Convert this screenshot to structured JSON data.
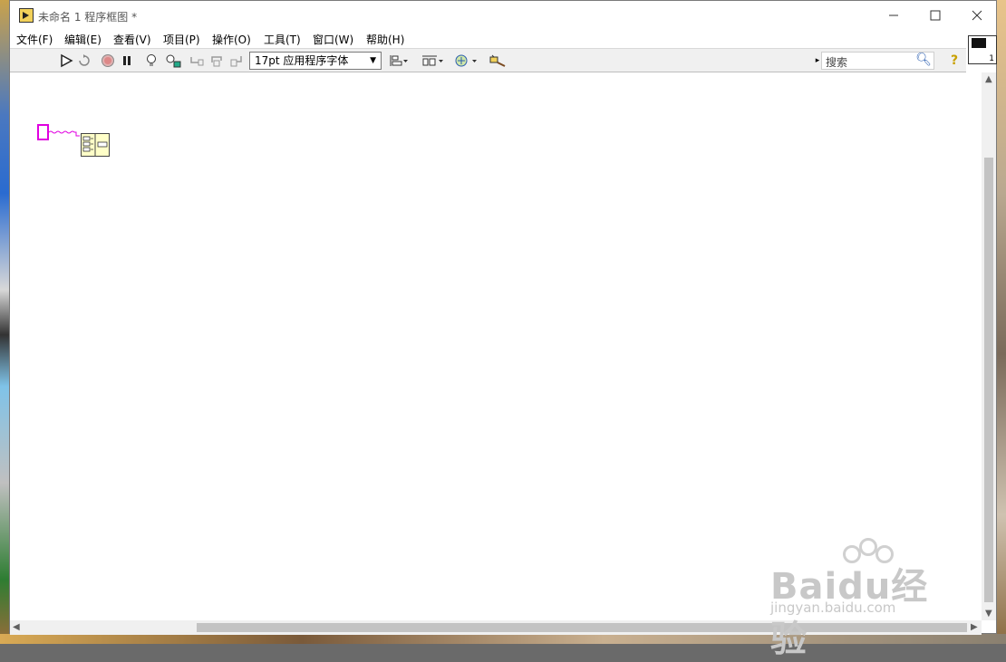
{
  "window": {
    "title": "未命名 1 程序框图 *"
  },
  "menu": [
    {
      "label": "文件(F)"
    },
    {
      "label": "编辑(E)"
    },
    {
      "label": "查看(V)"
    },
    {
      "label": "项目(P)"
    },
    {
      "label": "操作(O)"
    },
    {
      "label": "工具(T)"
    },
    {
      "label": "窗口(W)"
    },
    {
      "label": "帮助(H)"
    }
  ],
  "toolbar": {
    "font_selector": "17pt 应用程序字体",
    "search_placeholder": "搜索",
    "help_label": "?"
  },
  "connector_pane": {
    "number": "1"
  },
  "colors": {
    "wire": "#e000e0",
    "node_fill": "#ffffc8"
  },
  "watermark": {
    "brand": "Baidu经验",
    "url": "jingyan.baidu.com"
  }
}
